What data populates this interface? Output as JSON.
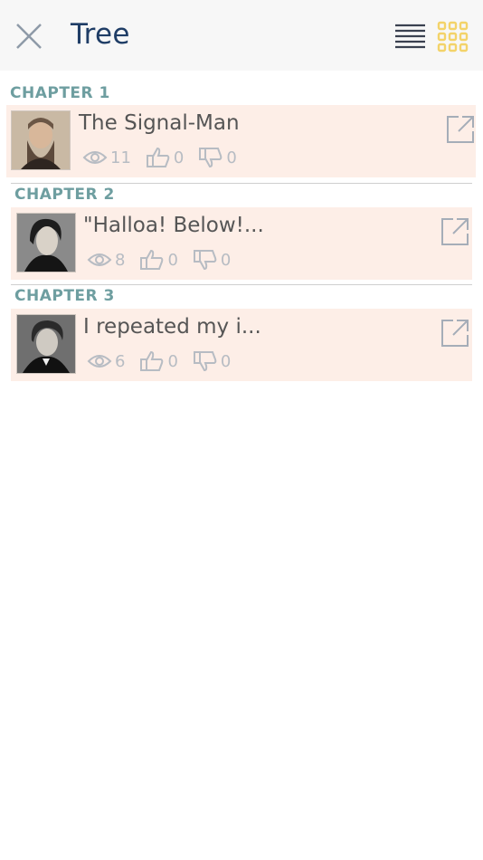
{
  "header": {
    "title": "Tree"
  },
  "chapters": [
    {
      "label": "CHAPTER 1",
      "title": "The Signal-Man",
      "views": "11",
      "likes": "0",
      "dislikes": "0"
    },
    {
      "label": "CHAPTER 2",
      "title": "\"Halloa! Below!...",
      "views": "8",
      "likes": "0",
      "dislikes": "0"
    },
    {
      "label": "CHAPTER 3",
      "title": "I repeated my i...",
      "views": "6",
      "likes": "0",
      "dislikes": "0"
    }
  ],
  "colors": {
    "accent": "#6e9ea0",
    "card_bg": "#fdeee7",
    "title": "#1f3d66",
    "grid_icon": "#f3d36a"
  }
}
